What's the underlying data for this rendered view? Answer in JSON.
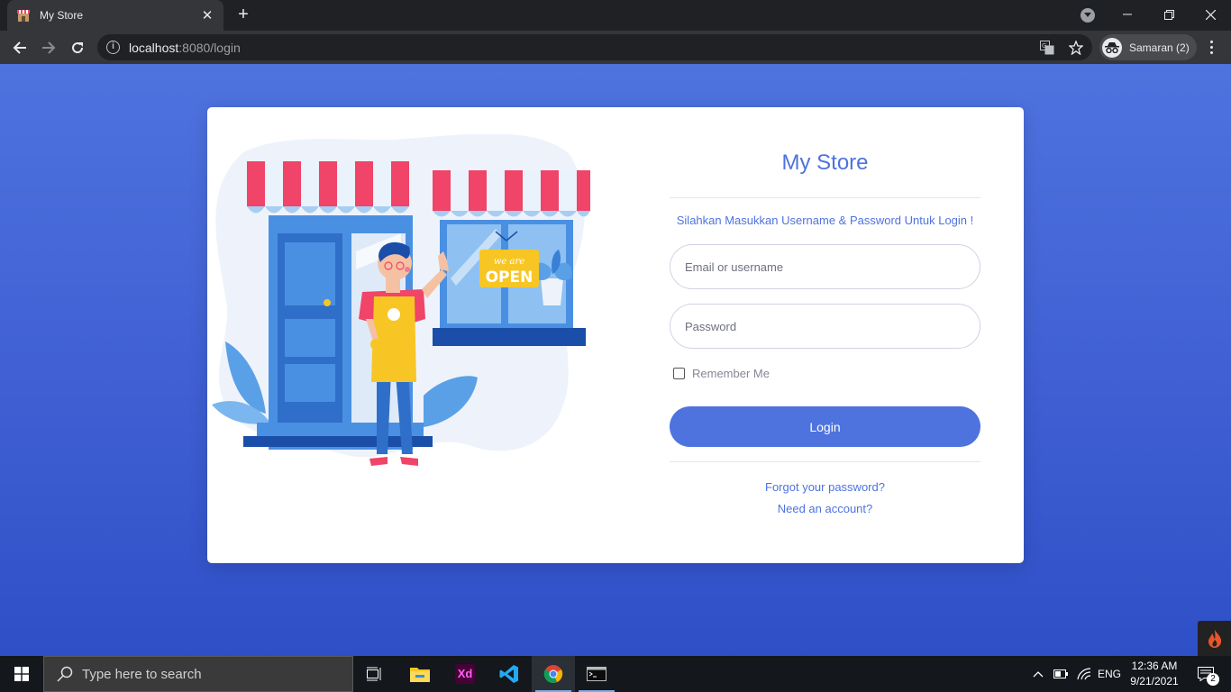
{
  "browser": {
    "tab": {
      "title": "My Store"
    },
    "new_tab_symbol": "+",
    "url_host": "localhost",
    "url_rest": ":8080/login",
    "profile_label": "Samaran (2)",
    "icons": [
      "store-favicon",
      "close-icon",
      "search-tabs-icon",
      "minimize-icon",
      "restore-icon",
      "window-close-icon",
      "back-icon",
      "forward-icon",
      "reload-icon",
      "info-icon",
      "translate-icon",
      "star-icon",
      "incognito-icon",
      "menu-icon"
    ]
  },
  "login": {
    "title": "My Store",
    "subtitle": "Silahkan Masukkan Username & Password Untuk Login !",
    "email_placeholder": "Email or username",
    "password_placeholder": "Password",
    "remember_label": "Remember Me",
    "login_button": "Login",
    "forgot_link": "Forgot your password?",
    "register_link": "Need an account?",
    "sign_text_1": "we are",
    "sign_text_2": "OPEN",
    "colors": {
      "accent": "#4e73df",
      "awning_red": "#f04468",
      "door_blue": "#4a90e2",
      "apron_yellow": "#f7c624"
    }
  },
  "taskbar": {
    "search_placeholder": "Type here to search",
    "xd_label": "Xd",
    "language": "ENG",
    "time": "12:36 AM",
    "date": "9/21/2021",
    "notification_count": "2"
  }
}
